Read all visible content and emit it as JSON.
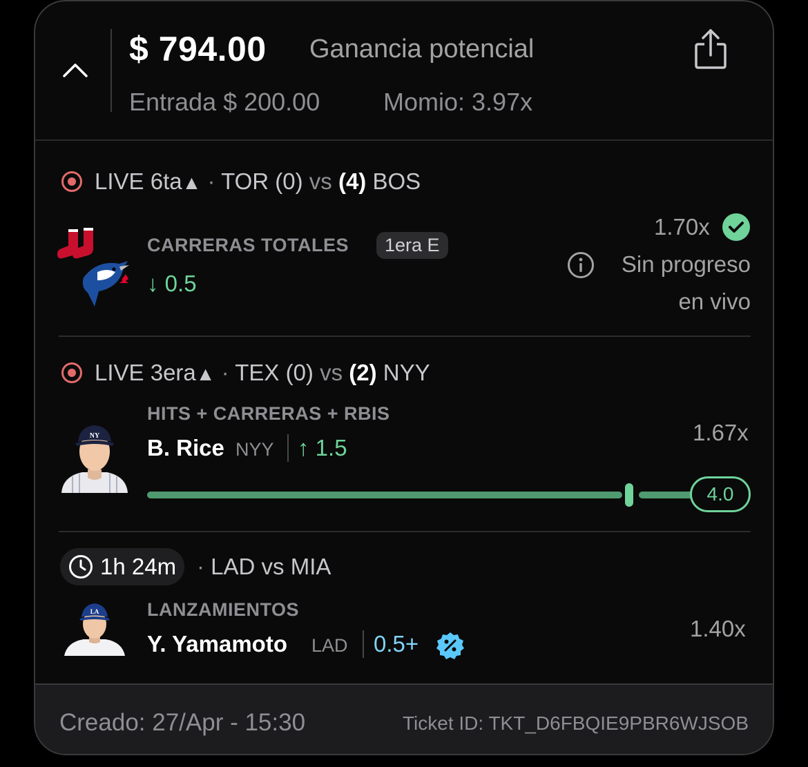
{
  "header": {
    "amount": "$ 794.00",
    "amount_label": "Ganancia potencial",
    "entry": "Entrada $ 200.00",
    "momio": "Momio: 3.97x"
  },
  "legs": [
    {
      "status": "LIVE 6ta",
      "game_away": "TOR (0)",
      "vs": "vs",
      "game_home_score": "(4)",
      "game_home": "BOS",
      "market": "CARRERAS TOTALES",
      "pill": "1era E",
      "line": "↓ 0.5",
      "odds": "1.70x",
      "note_line1": "Sin progreso",
      "note_line2": "en vivo"
    },
    {
      "status": "LIVE 3era",
      "game_away": "TEX (0)",
      "vs": "vs",
      "game_home_score": "(2)",
      "game_home": "NYY",
      "market": "HITS + CARRERAS + RBIS",
      "player": "B. Rice",
      "team": "NYY",
      "line": "↑ 1.5",
      "odds": "1.67x",
      "progress_target": "4.0",
      "progress_fraction": 0.88
    },
    {
      "timer": "1h 24m",
      "game": "LAD vs MIA",
      "market": "LANZAMIENTOS",
      "player": "Y. Yamamoto",
      "team": "LAD",
      "line": "0.5+",
      "odds": "1.40x"
    }
  ],
  "footer": {
    "created": "Creado: 27/Apr - 15:30",
    "ticket": "Ticket ID: TKT_D6FBQIE9PBR6WJSOB"
  },
  "colors": {
    "live": "#e46a6a",
    "green": "#6fd39a",
    "boost": "#5ac8fa"
  },
  "icons": [
    "chevron-up-icon",
    "share-icon",
    "live-indicator-icon",
    "check-circle-icon",
    "info-icon",
    "clock-icon",
    "boost-badge-icon"
  ]
}
